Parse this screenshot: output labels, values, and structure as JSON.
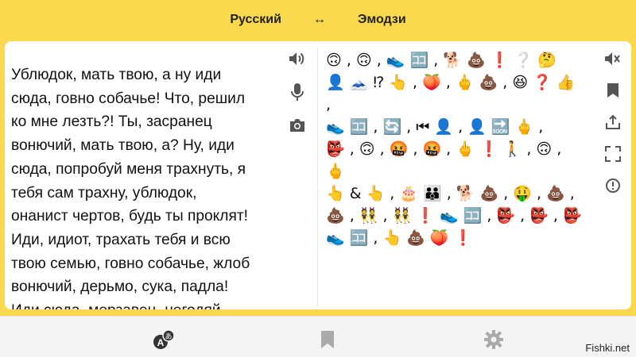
{
  "header": {
    "source_lang": "Русский",
    "swap_icon": "↔",
    "target_lang": "Эмодзи"
  },
  "source": {
    "text": "Ублюдок, мать твою, а ну иди\nсюда, говно собачье! Что, решил\nко мне лезть?! Ты, засранец\nвонючий, мать твою, а? Ну, иди\nсюда, попробуй меня трахнуть, я\nтебя сам трахну, ублюдок,\nонанист чертов, будь ты проклят!\nИди, идиот, трахать тебя и всю\nтвою семью, говно собачье, жлоб\nвонючий, дерьмо, сука, падла!\nИди сюда, мерзавец, негодяй,\nгад, иди сюда, ты, говно, ЖОПА!",
    "tools": [
      "speaker-icon",
      "microphone-icon",
      "camera-icon"
    ]
  },
  "target": {
    "text": "🙃 , 🙃 , 👟 🈁 , 🐕 💩 ❗ ❔ 🤔\n👤 🗻 ⁉ 👆 , 🍑 , 🖕 💩 , 😆 ❓ 👍 ,\n👟 🈁 , 🔄 , ⏮ 👤 , 👤 🔜 🖕 ,\n👺 , 🙃 , 🤬 , 🤬 , 🖕 ❗ 🚶 , 🙃 , 🖕\n👆 & 👆 , 🎂 👪 , 🐕 💩 , 🤑 , 💩 ,\n💩 , 👯 , 👯 ❗ 👟 🈁 , 👺 , 👺 , 👺\n👟 🈁 , 👆 💩 🍑 ❗",
    "tools": [
      "mute-icon",
      "bookmark-icon",
      "share-icon",
      "fullscreen-icon",
      "report-icon"
    ]
  },
  "bottom_nav": [
    "translate-icon",
    "bookmarks-icon",
    "settings-icon"
  ],
  "colors": {
    "accent": "#fbd94e",
    "icon": "#555555",
    "bar": "#f4f4f4"
  },
  "watermark": "Fishki.net"
}
